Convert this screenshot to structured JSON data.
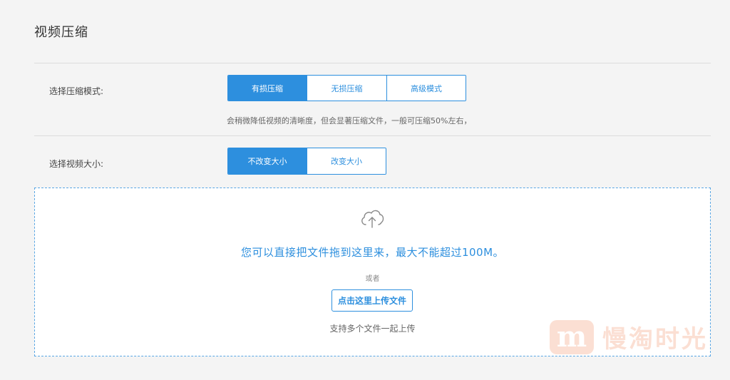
{
  "page": {
    "title": "视频压缩"
  },
  "compression_mode": {
    "label": "选择压缩模式:",
    "options": [
      "有损压缩",
      "无损压缩",
      "高级模式"
    ],
    "selected": "有损压缩",
    "hint": "会稍微降低视频的清晰度，但会显著压缩文件，一般可压缩50%左右，"
  },
  "video_size": {
    "label": "选择视频大小:",
    "options": [
      "不改变大小",
      "改变大小"
    ],
    "selected": "不改变大小"
  },
  "dropzone": {
    "icon": "cloud-upload-icon",
    "main_text": "您可以直接把文件拖到这里来，最大不能超过100M。",
    "or_text": "或者",
    "upload_button": "点击这里上传文件",
    "multi_text": "支持多个文件一起上传"
  },
  "watermark": {
    "text": "慢淘时光"
  },
  "colors": {
    "accent": "#2d8fde",
    "background": "#f4f4f4",
    "watermark": "#f4a684"
  }
}
